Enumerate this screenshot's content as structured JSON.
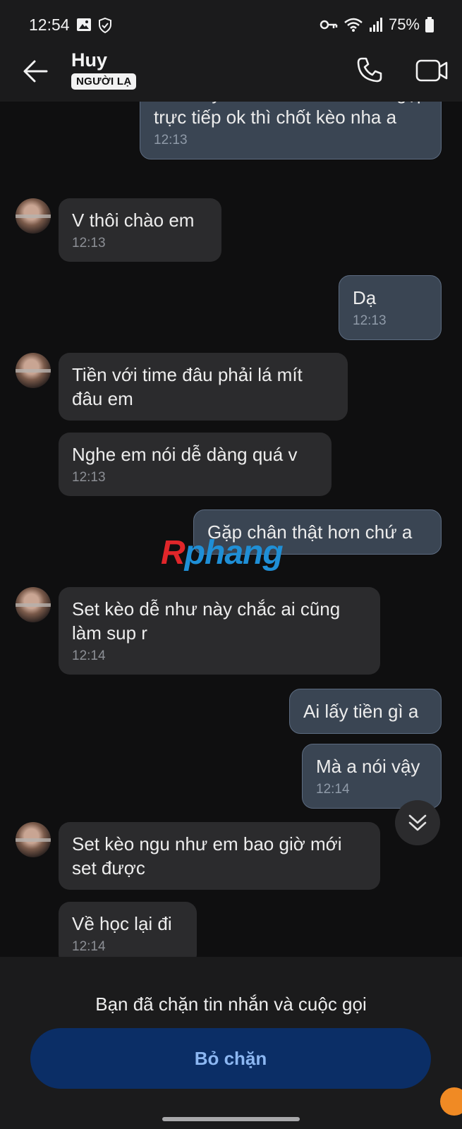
{
  "status_bar": {
    "time": "12:54",
    "battery": "75%"
  },
  "header": {
    "contact_name": "Huy",
    "badge": "NGƯỜI LẠ"
  },
  "messages": [
    {
      "text": "Kèo này k có xem hình nha a.gặp trực tiếp ok thì chốt kèo nha a",
      "time": "12:13"
    },
    {
      "text": "V thôi chào em",
      "time": "12:13"
    },
    {
      "text": "Dạ",
      "time": "12:13"
    },
    {
      "text": "Tiền với time đâu phải lá mít đâu em"
    },
    {
      "text": "Nghe em nói dễ dàng quá v",
      "time": "12:13"
    },
    {
      "text": "Gặp chân thật hơn chứ a"
    },
    {
      "text": "Set kèo dễ như này chắc ai cũng làm sup r",
      "time": "12:14"
    },
    {
      "text": "Ai lấy tiền gì a"
    },
    {
      "text": "Mà a nói vậy",
      "time": "12:14"
    },
    {
      "text": "Set kèo ngu như em bao giờ mới set được"
    },
    {
      "text": "Về học lại đi",
      "time": "12:14"
    }
  ],
  "watermark": {
    "part1": "R",
    "part2": "phang"
  },
  "footer": {
    "blocked_text": "Bạn đã chặn tin nhắn và cuộc gọi",
    "unblock_label": "Bỏ chặn"
  }
}
